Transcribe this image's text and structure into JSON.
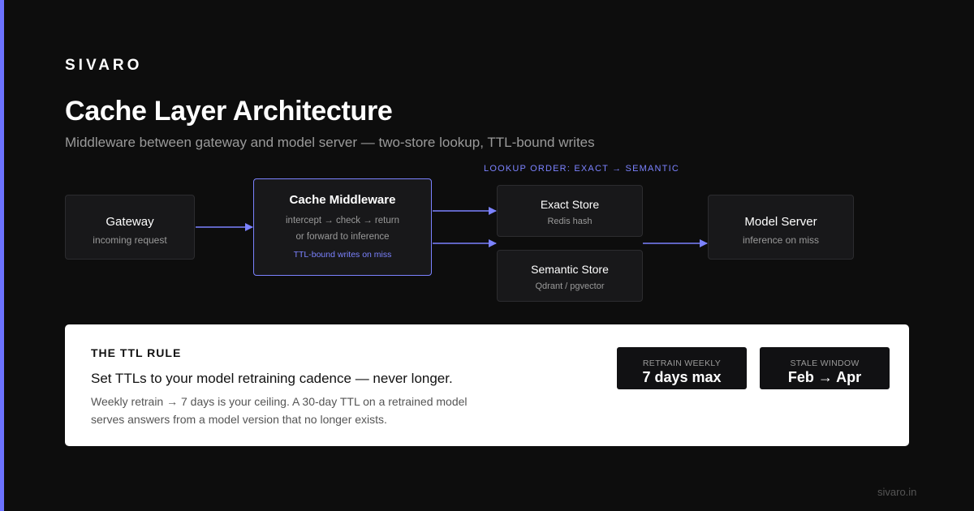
{
  "brand": "SIVARO",
  "title": "Cache Layer Architecture",
  "subtitle": "Middleware between gateway and model server — two-store lookup, TTL-bound writes",
  "lookup_order_label": "LOOKUP ORDER: EXACT → SEMANTIC",
  "colors": {
    "accent": "#6c72ff",
    "node_bg": "#18181a",
    "node_border": "#2c2c2f",
    "page_bg": "#0d0d0d"
  },
  "nodes": {
    "gateway": {
      "name": "Gateway",
      "sub": "incoming request"
    },
    "cache": {
      "name": "Cache Middleware",
      "line1": "intercept → check → return",
      "line2": "or forward to inference",
      "ttl": "TTL-bound writes on miss"
    },
    "exact": {
      "name": "Exact Store",
      "sub": "Redis hash"
    },
    "semantic": {
      "name": "Semantic Store",
      "sub": "Qdrant / pgvector"
    },
    "model": {
      "name": "Model Server",
      "sub": "inference on miss"
    }
  },
  "edges": [
    {
      "from": "gateway",
      "to": "cache"
    },
    {
      "from": "cache",
      "to": "exact"
    },
    {
      "from": "cache",
      "to": "semantic"
    },
    {
      "from": "semantic",
      "to": "model"
    }
  ],
  "ttl_card": {
    "heading": "THE TTL RULE",
    "main": "Set TTLs to your model retraining cadence — never longer.",
    "body": "Weekly retrain → 7 days is your ceiling. A 30-day TTL on a retrained model serves answers from a model version that no longer exists.",
    "stats": [
      {
        "label": "RETRAIN WEEKLY",
        "value": "7 days max"
      },
      {
        "label": "STALE WINDOW",
        "value": "Feb → Apr"
      }
    ]
  },
  "footer": "sivaro.in"
}
